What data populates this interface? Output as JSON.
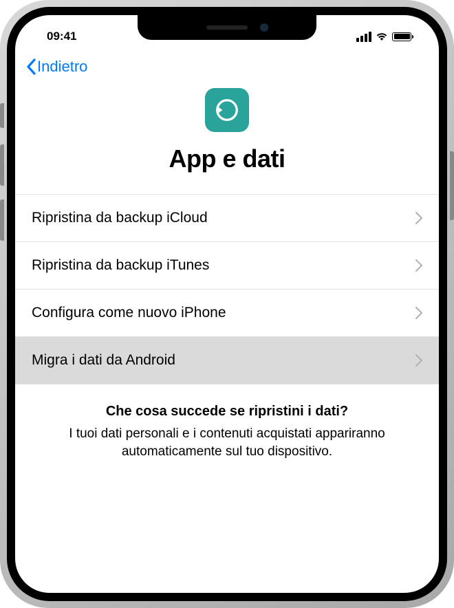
{
  "status": {
    "time": "09:41"
  },
  "nav": {
    "back_label": "Indietro"
  },
  "header": {
    "title": "App e dati"
  },
  "options": [
    {
      "label": "Ripristina da backup iCloud",
      "selected": false
    },
    {
      "label": "Ripristina da backup iTunes",
      "selected": false
    },
    {
      "label": "Configura come nuovo iPhone",
      "selected": false
    },
    {
      "label": "Migra i dati da Android",
      "selected": true
    }
  ],
  "footer": {
    "title": "Che cosa succede se ripristini i dati?",
    "body": "I tuoi dati personali e i contenuti acquistati appariranno automaticamente sul tuo dispositivo."
  },
  "colors": {
    "accent": "#007aff",
    "icon_bg": "#2aa39a"
  }
}
